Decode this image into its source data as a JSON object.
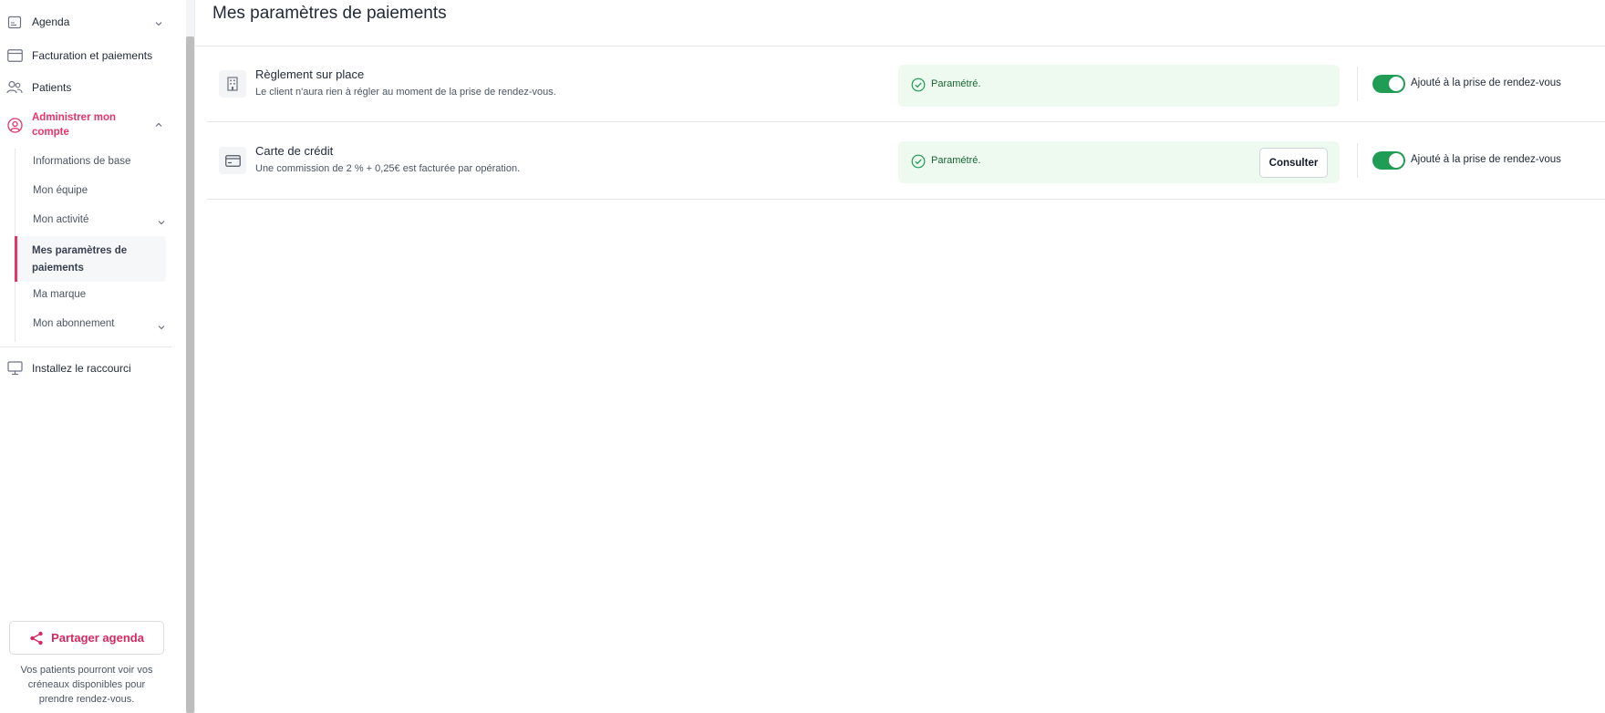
{
  "sidebar": {
    "items": {
      "agenda": {
        "label": "Agenda"
      },
      "billing": {
        "label": "Facturation et paiements"
      },
      "patients": {
        "label": "Patients"
      },
      "account": {
        "label_line1": "Administrer mon",
        "label_line2": "compte"
      },
      "shortcut": {
        "label": "Installez le raccourci"
      }
    },
    "sub_items": {
      "basics": "Informations de base",
      "team": "Mon équipe",
      "activity": "Mon activité",
      "payments_line1": "Mes paramètres de",
      "payments_line2": "paiements",
      "brand": "Ma marque",
      "subscription": "Mon abonnement"
    },
    "share": {
      "button_label": "Partager agenda",
      "line1": "Vos patients pourront voir vos",
      "line2": "créneaux disponibles pour",
      "line3": "prendre rendez-vous."
    },
    "accent_color": "#e8336b"
  },
  "main": {
    "title": "Mes paramètres de paiements",
    "rows": [
      {
        "icon": "building-icon",
        "title": "Règlement sur place",
        "description": "Le client n'aura rien à régler au moment de la prise de rendez-vous.",
        "status": "Paramétré.",
        "toggle_on": true,
        "toggle_label": "Ajouté à la prise de rendez-vous"
      },
      {
        "icon": "credit-card-icon",
        "title": "Carte de crédit",
        "description": "Une commission de 2 % + 0,25€ est facturée par opération.",
        "status": "Paramétré.",
        "action_label": "Consulter",
        "toggle_on": true,
        "toggle_label": "Ajouté à la prise de rendez-vous"
      }
    ],
    "status_color": "#1f9d55"
  }
}
